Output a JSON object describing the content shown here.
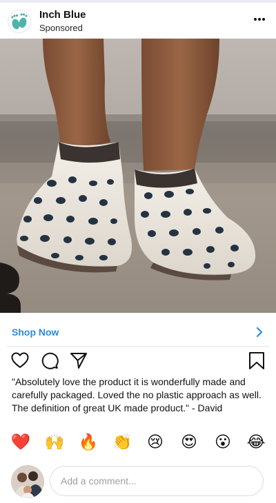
{
  "post": {
    "brand_name": "Inch Blue",
    "sponsored_label": "Sponsored",
    "more_icon": "more-horizontal-icon",
    "image_alt": "Toddler feet wearing white soft leather shoes with navy polka dots"
  },
  "cta": {
    "label": "Shop Now",
    "icon": "chevron-right-icon",
    "color": "#2d8bd9"
  },
  "actions": {
    "icons": [
      "heart-icon",
      "comment-icon",
      "share-icon",
      "bookmark-icon"
    ]
  },
  "caption": {
    "text": "\"Absolutely love the product it is wonderfully made and carefully packaged. Loved the no plastic approach as well. The definition of great UK made product.\" - David"
  },
  "reactions": {
    "items": [
      {
        "name": "red-heart",
        "glyph": "❤️"
      },
      {
        "name": "raising-hands",
        "glyph": "🙌"
      },
      {
        "name": "fire",
        "glyph": "🔥"
      },
      {
        "name": "clapping-hands",
        "glyph": "👏"
      },
      {
        "name": "crying-face",
        "glyph": "😢"
      },
      {
        "name": "heart-eyes",
        "glyph": "😍"
      },
      {
        "name": "surprised-face",
        "glyph": "😮"
      },
      {
        "name": "tears-of-joy",
        "glyph": "😂"
      }
    ]
  },
  "comment": {
    "placeholder": "Add a comment..."
  }
}
